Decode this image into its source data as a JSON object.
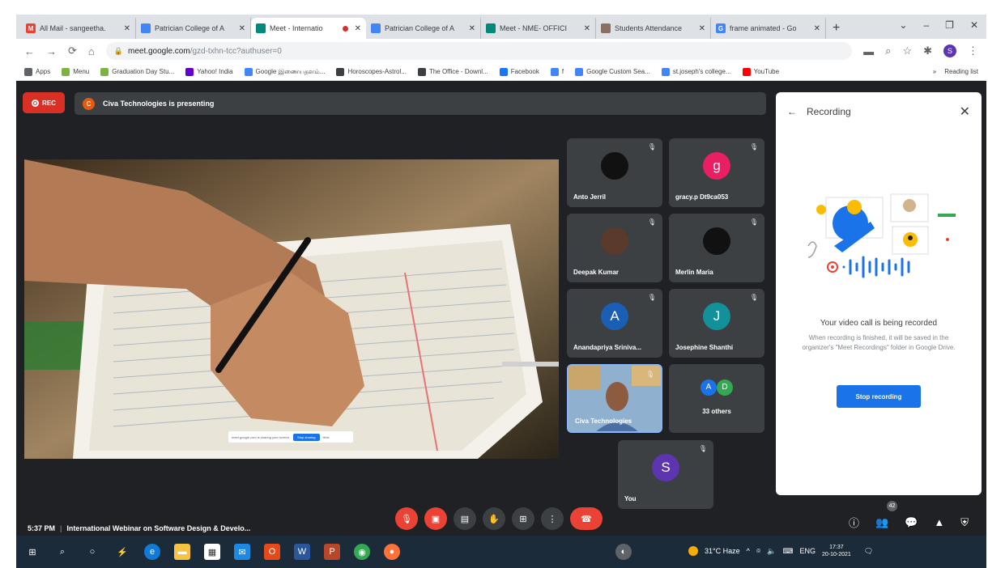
{
  "browser": {
    "tabs": [
      {
        "title": "All Mail - sangeetha.",
        "favicon": "gmail-icon",
        "color": "#ea4335",
        "glyph": "M"
      },
      {
        "title": "Patrician College of A",
        "favicon": "site-icon",
        "color": "#4285f4",
        "glyph": ""
      },
      {
        "title": "Meet - Internatio",
        "favicon": "meet-icon",
        "color": "#00897b",
        "glyph": "",
        "recording": true,
        "active": true
      },
      {
        "title": "Patrician College of A",
        "favicon": "site-icon",
        "color": "#4285f4",
        "glyph": ""
      },
      {
        "title": "Meet - NME- OFFICI",
        "favicon": "meet-icon",
        "color": "#00897b",
        "glyph": ""
      },
      {
        "title": "Students Attendance",
        "favicon": "doc-icon",
        "color": "#8d6e63",
        "glyph": ""
      },
      {
        "title": "frame animated - Go",
        "favicon": "google-icon",
        "color": "#4285f4",
        "glyph": "G"
      }
    ],
    "new_tab": "+",
    "window_controls": [
      "⌄",
      "–",
      "❐",
      "✕"
    ],
    "address": {
      "host": "meet.google.com",
      "path": "/gzd-txhn-tcc?authuser=0"
    },
    "profile_initial": "S",
    "bookmarks": [
      {
        "label": "Apps",
        "color": "#5f6368"
      },
      {
        "label": "Menu",
        "color": "#7cb342"
      },
      {
        "label": "Graduation Day Stu...",
        "color": "#7cb342"
      },
      {
        "label": "Yahoo! India",
        "color": "#6001d2"
      },
      {
        "label": "Google இணையதளம்...",
        "color": "#4285f4"
      },
      {
        "label": "Horoscopes-Astrol...",
        "color": "#3c4043"
      },
      {
        "label": "The Office - Downl...",
        "color": "#3c4043"
      },
      {
        "label": "Facebook",
        "color": "#1877f2"
      },
      {
        "label": "f",
        "color": "#4285f4"
      },
      {
        "label": "Google Custom Sea...",
        "color": "#4285f4"
      },
      {
        "label": "st.joseph's college...",
        "color": "#4285f4"
      },
      {
        "label": "YouTube",
        "color": "#ff0000"
      }
    ],
    "bookmarks_more": "»",
    "reading_list": "Reading list"
  },
  "meet": {
    "rec_label": "REC",
    "presenter_initial": "C",
    "presenting_text": "Civa Technologies is presenting",
    "participants": [
      {
        "name": "Anto Jerril",
        "initial": "",
        "color": "#111111"
      },
      {
        "name": "gracy.p Dt9ca053",
        "initial": "g",
        "color": "#e91e63"
      },
      {
        "name": "Deepak Kumar",
        "initial": "",
        "color": "#5a3a2a"
      },
      {
        "name": "Merlin Maria",
        "initial": "",
        "color": "#111111"
      },
      {
        "name": "Anandapriya Sriniva...",
        "initial": "A",
        "color": "#1a5fb4"
      },
      {
        "name": "Josephine Shanthi",
        "initial": "J",
        "color": "#12919a"
      },
      {
        "name": "Civa Technologies",
        "initial": "",
        "color": "#7fa7c9"
      },
      {
        "name": "33 others",
        "initial": "",
        "color": "#3c4043"
      },
      {
        "name": "You",
        "initial": "S",
        "color": "#5e35b1"
      }
    ],
    "others_avatars": [
      {
        "initial": "A",
        "color": "#1a73e8"
      },
      {
        "initial": "D",
        "color": "#34a853"
      }
    ],
    "snackbar": {
      "text": "meet.google.com is sharing your screen.",
      "button": "Stop sharing",
      "hide": "Hide"
    },
    "panel": {
      "title": "Recording",
      "heading": "Your video call is being recorded",
      "description": "When recording is finished, it will be saved in the organizer's \"Meet Recordings\" folder in Google Drive.",
      "button": "Stop recording"
    },
    "time": "5:37 PM",
    "meeting_title": "International Webinar on Software Design & Develo...",
    "participant_count": "42",
    "accent": "#1a73e8",
    "danger": "#ea4335"
  },
  "taskbar": {
    "weather": "31°C Haze",
    "language": "ENG",
    "clock_time": "17:37",
    "clock_date": "20-10-2021",
    "notifications": "4"
  }
}
